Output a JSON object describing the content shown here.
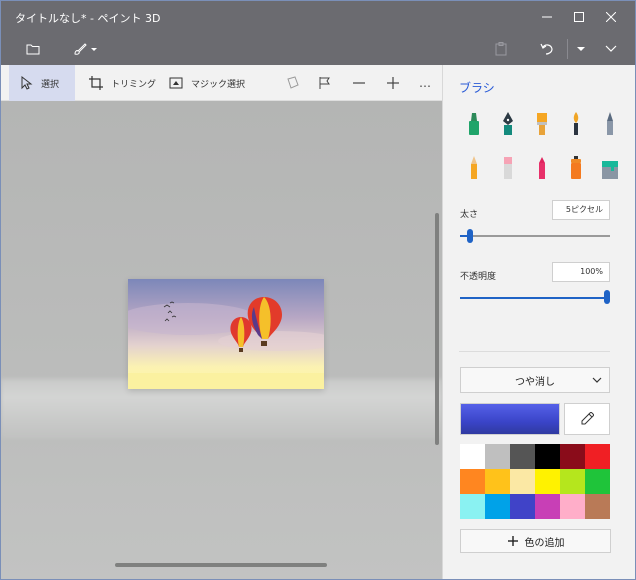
{
  "app": {
    "title": "タイトルなし* - ペイント 3D"
  },
  "toolbar": {
    "select_label": "選択",
    "crop_label": "トリミング",
    "magic_select_label": "マジック選択",
    "more_label": "…"
  },
  "panel": {
    "title": "ブラシ",
    "thickness_label": "太さ",
    "thickness_value": "5ピクセル",
    "thickness_fraction": 0.05,
    "opacity_label": "不透明度",
    "opacity_value": "100%",
    "opacity_fraction": 1.0,
    "finish_selected": "つや消し",
    "add_color_label": "色の追加",
    "current_color": "#4550d6",
    "palette": [
      "#ffffff",
      "#bfbfbf",
      "#555555",
      "#000000",
      "#8a0c1a",
      "#f01f24",
      "#ff8620",
      "#ffc21a",
      "#fbe8a4",
      "#fff200",
      "#b5e61d",
      "#1fc43a",
      "#8af2f2",
      "#00a2e8",
      "#4043c8",
      "#c83fb6",
      "#ffaec9",
      "#b97a57"
    ],
    "brushes": [
      "marker-icon",
      "calligraphy-pen-icon",
      "oil-brush-icon",
      "watercolor-icon",
      "pixel-pen-icon",
      "pencil-icon",
      "eraser-icon",
      "crayon-icon",
      "spray-can-icon",
      "fill-bucket-icon"
    ]
  },
  "colors": {
    "accent": "#2a5bd7",
    "titlebar": "#6b6b70",
    "slider": "#1f63c6"
  }
}
